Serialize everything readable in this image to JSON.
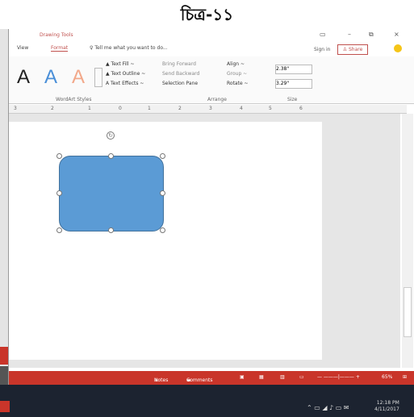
{
  "caption": "চিত্র-১১",
  "contextual_tab": "Drawing Tools",
  "tabs": [
    {
      "label": "View",
      "active": false
    },
    {
      "label": "Format",
      "active": true
    }
  ],
  "tell_me": "Tell me what you want to do...",
  "window": {
    "minimize": "–",
    "restore": "⧉",
    "close": "×",
    "ribbon_opts": "▭"
  },
  "account": {
    "sign_in": "Sign in",
    "share": "Share"
  },
  "wordart": {
    "a1": "A",
    "a2": "A",
    "a3": "A"
  },
  "text_cmds": {
    "fill": "Text Fill ~",
    "outline": "Text Outline ~",
    "effects": "Text Effects ~"
  },
  "arrange": {
    "bring_forward": "Bring Forward",
    "send_backward": "Send Backward",
    "selection_pane": "Selection Pane",
    "align": "Align ~",
    "group": "Group ~",
    "rotate": "Rotate ~"
  },
  "size": {
    "height": "2.38\"",
    "width": "3.29\""
  },
  "group_labels": {
    "wordart": "WordArt Styles",
    "arrange": "Arrange",
    "size": "Size"
  },
  "ruler_labels": [
    "3",
    "2",
    "1",
    "0",
    "1",
    "2",
    "3",
    "4",
    "5",
    "6"
  ],
  "status": {
    "notes": "Notes",
    "comments": "Comments",
    "zoom": "65%"
  },
  "clock": {
    "time": "12:18 PM",
    "date": "4/11/2017"
  },
  "colors": {
    "accent": "#c9352a",
    "shape_fill": "#5b9bd5",
    "wordart_blue": "#4a8fd8",
    "wordart_orange": "#f2a88a"
  }
}
